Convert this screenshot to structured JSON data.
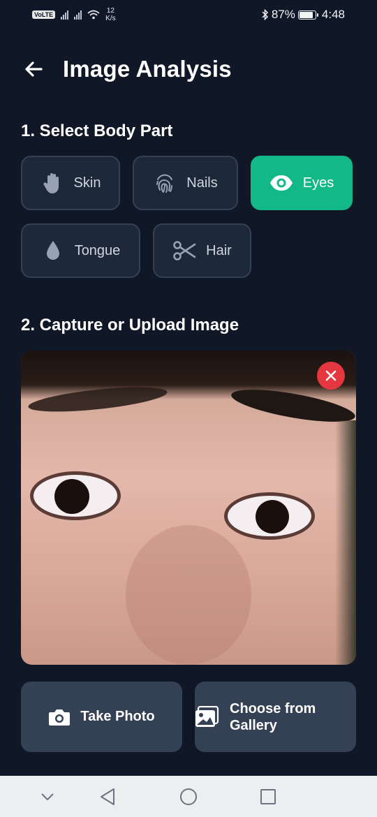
{
  "status_bar": {
    "volte": "VoLTE",
    "net_speed_value": "12",
    "net_speed_unit": "K/s",
    "battery": "87%",
    "time": "4:48"
  },
  "header": {
    "title": "Image Analysis"
  },
  "body_part_section": {
    "title": "1. Select Body Part",
    "options": [
      {
        "label": "Skin",
        "icon": "hand-icon",
        "selected": false
      },
      {
        "label": "Nails",
        "icon": "fingerprint-icon",
        "selected": false
      },
      {
        "label": "Eyes",
        "icon": "eye-icon",
        "selected": true
      },
      {
        "label": "Tongue",
        "icon": "droplet-icon",
        "selected": false
      },
      {
        "label": "Hair",
        "icon": "scissors-icon",
        "selected": false
      }
    ]
  },
  "capture_section": {
    "title": "2. Capture or Upload Image"
  },
  "actions": {
    "take_photo": "Take Photo",
    "choose_gallery_line1": "Choose from",
    "choose_gallery_line2": "Gallery"
  },
  "colors": {
    "background": "#101828",
    "chip": "#1d2939",
    "chip_border": "#344054",
    "accent": "#12b886",
    "action_button": "#344054",
    "remove": "#e5373f"
  }
}
